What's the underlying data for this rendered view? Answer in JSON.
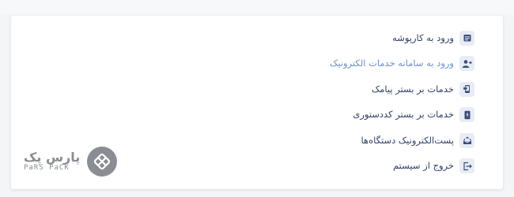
{
  "menu": {
    "items": [
      {
        "label": "ورود به کارپوشه",
        "icon": "folder-icon",
        "active": false
      },
      {
        "label": "ورود به سامانه خدمات الکترونیک",
        "icon": "user-login-icon",
        "active": true
      },
      {
        "label": "خدمات بر بستر پیامک",
        "icon": "sms-phone-icon",
        "active": false
      },
      {
        "label": "خدمات بر بستر کددستوری",
        "icon": "ussd-code-icon",
        "active": false
      },
      {
        "label": "پست‌الکترونیک دستگاه‌ها",
        "icon": "email-icon",
        "active": false
      },
      {
        "label": "خروج از سیستم",
        "icon": "logout-icon",
        "active": false
      }
    ]
  },
  "logo": {
    "text_fa": "پارس پک",
    "text_en": "PaRS PaCK"
  },
  "colors": {
    "label": "#2f3f66",
    "active_label": "#6d90cc",
    "icon_bg": "#e7ecf5",
    "icon_fg": "#3a4d78",
    "logo": "#8a8d93"
  }
}
